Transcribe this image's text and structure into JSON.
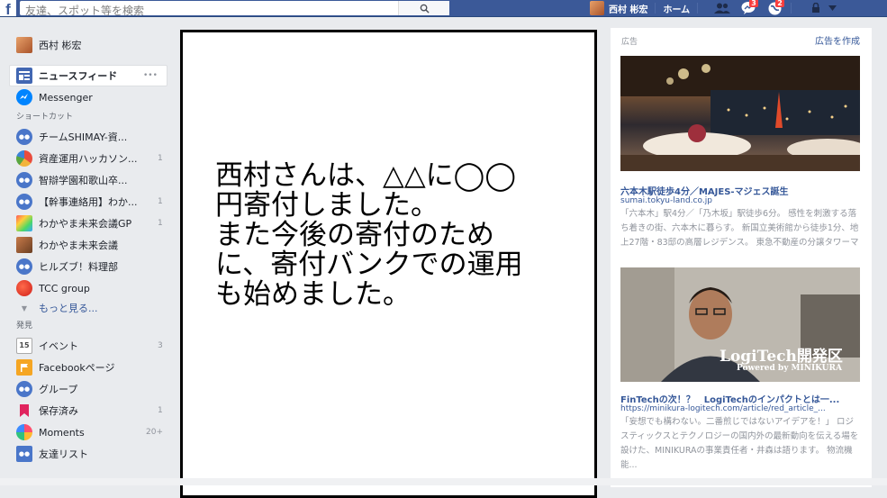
{
  "colors": {
    "brand": "#3b5998",
    "link": "#365899",
    "badge": "#fa3e3e"
  },
  "topbar": {
    "logo": "f",
    "search_placeholder": "友達、スポット等を検索",
    "user_name": "西村 彬宏",
    "home_label": "ホーム",
    "message_badge": "3",
    "notification_badge": "2"
  },
  "sidebar": {
    "user_name": "西村 彬宏",
    "news_feed": "ニュースフィード",
    "news_feed_more": "•••",
    "messenger": "Messenger",
    "shortcuts_title": "ショートカット",
    "shortcuts": [
      {
        "label": "チームSHIMAY-資...",
        "count": ""
      },
      {
        "label": "資産運用ハッカソン...",
        "count": "1"
      },
      {
        "label": "智辯学園和歌山卒...",
        "count": ""
      },
      {
        "label": "【幹事連絡用】わか...",
        "count": "1"
      },
      {
        "label": "わかやま未来会議GP",
        "count": "1"
      },
      {
        "label": "わかやま未来会議",
        "count": ""
      },
      {
        "label": "ヒルズブ！料理部",
        "count": ""
      },
      {
        "label": "TCC group",
        "count": ""
      }
    ],
    "see_more": "もっと見る...",
    "explore_title": "発見",
    "explore": [
      {
        "label": "イベント",
        "count": "3",
        "icon": "calendar-icon",
        "day": "15"
      },
      {
        "label": "Facebookページ",
        "count": "",
        "icon": "flag-icon"
      },
      {
        "label": "グループ",
        "count": "",
        "icon": "groups-icon"
      },
      {
        "label": "保存済み",
        "count": "1",
        "icon": "bookmark-icon"
      },
      {
        "label": "Moments",
        "count": "20+",
        "icon": "moments-icon"
      },
      {
        "label": "友達リスト",
        "count": "",
        "icon": "friends-list-icon"
      }
    ]
  },
  "post": {
    "text": "西村さんは、△△に◯◯\n円寄付しました。\nまた今後の寄付のため\nに、寄付バンクでの運用\nも始めました。"
  },
  "ads": {
    "header": "広告",
    "create": "広告を作成",
    "items": [
      {
        "title": "六本木駅徒歩4分／MAJES-マジェス誕生",
        "url": "sumai.tokyu-land.co.jp",
        "desc": "「六本木」駅4分／「乃木坂」駅徒歩6分。 感性を刺激する落ち着きの街、六本木に暮らす。 新国立美術館から徒歩1分、地上27階・83邸の高層レジデンス。 東急不動産の分譲タワーマンシ..."
      },
      {
        "title": "FinTechの次！？　LogiTechのインパクトとは一...",
        "url": "https://minikura-logitech.com/article/red_article_...",
        "desc": "「妄想でも構わない。二番煎じではないアイデアを！」 ロジスティックスとテクノロジーの国内外の最新動向を伝える場を設けた、MINIKURAの事業責任者・井森は語ります。 物流機能...",
        "image_title": "LogiTech開発区",
        "image_sub": "Powered by MINIKURA"
      }
    ]
  }
}
